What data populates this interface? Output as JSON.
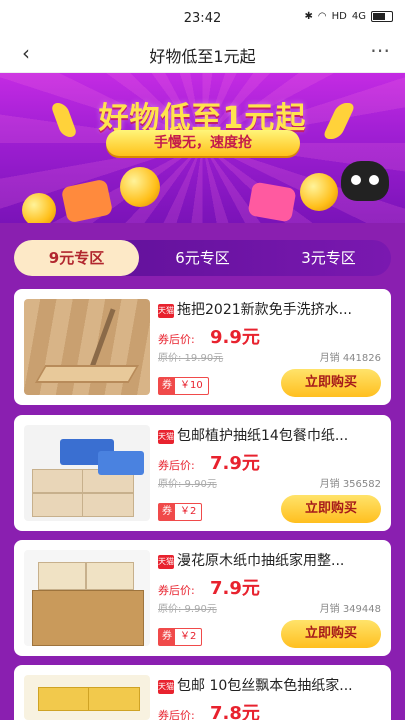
{
  "status": {
    "time": "23:42",
    "network": "HD",
    "signal": "4G"
  },
  "nav": {
    "title": "好物低至1元起",
    "back_icon": "chevron-left-icon",
    "more_icon": "more-icon"
  },
  "banner": {
    "headline": "好物低至1元起",
    "slogan": "手慢无，速度抢"
  },
  "tabs": [
    {
      "label": "9元专区",
      "active": true
    },
    {
      "label": "6元专区",
      "active": false
    },
    {
      "label": "3元专区",
      "active": false
    }
  ],
  "labels": {
    "price_prefix": "券后价:",
    "buy": "立即购买",
    "coupon_key": "券",
    "tmall": "天猫"
  },
  "products": [
    {
      "title": "拖把2021新款免手洗挤水...",
      "price": "9.9元",
      "orig": "原价: 19.90元",
      "sales": "月销 441826",
      "coupon": "￥10"
    },
    {
      "title": "包邮植护抽纸14包餐巾纸...",
      "price": "7.9元",
      "orig": "原价: 9.90元",
      "sales": "月销 356582",
      "coupon": "￥2"
    },
    {
      "title": "漫花原木纸巾抽纸家用整...",
      "price": "7.9元",
      "orig": "原价: 9.90元",
      "sales": "月销 349448",
      "coupon": "￥2"
    },
    {
      "title": "包邮 10包丝飘本色抽纸家...",
      "price": "7.8元"
    }
  ]
}
